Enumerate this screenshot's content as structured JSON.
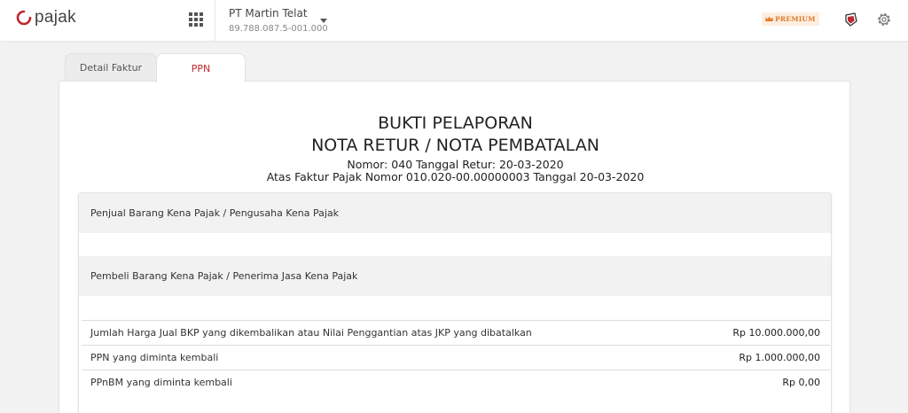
{
  "app": {
    "logo_text": "pajak",
    "brand_color": "#c0282d"
  },
  "header": {
    "apps_icon": "grid-icon",
    "company_name": "PT Martin Telat",
    "company_npwp": "89.788.087.5-001.000",
    "premium_label": "PREMIUM",
    "shield_icon": "shield-icon",
    "settings_icon": "gear-icon"
  },
  "tabs": [
    {
      "label": "Detail Faktur",
      "active": false
    },
    {
      "label": "PPN",
      "active": true
    }
  ],
  "document": {
    "title_line1": "BUKTI PELAPORAN",
    "title_line2": "NOTA RETUR / NOTA PEMBATALAN",
    "subtitle_line1": "Nomor: 040 Tanggal Retur: 20-03-2020",
    "subtitle_line2": "Atas Faktur Pajak Nomor 010.020-00.00000003 Tanggal 20-03-2020"
  },
  "sections": {
    "seller_heading": "Penjual Barang Kena Pajak / Pengusaha Kena Pajak",
    "buyer_heading": "Pembeli Barang Kena Pajak / Penerima Jasa Kena Pajak"
  },
  "summary": [
    {
      "label": "Jumlah Harga Jual BKP yang dikembalikan atau Nilai Penggantian atas JKP yang dibatalkan",
      "amount": "Rp 10.000.000,00"
    },
    {
      "label": "PPN yang diminta kembali",
      "amount": "Rp 1.000.000,00"
    },
    {
      "label": "PPnBM yang diminta kembali",
      "amount": "Rp 0,00"
    }
  ]
}
